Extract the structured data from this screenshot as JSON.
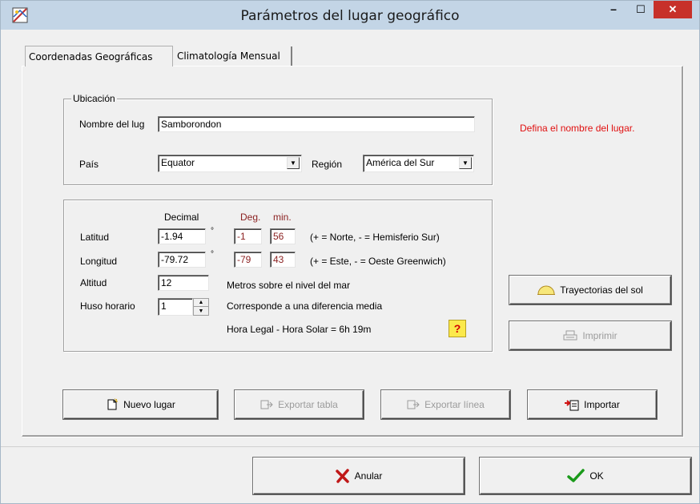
{
  "window": {
    "title": "Parámetros del lugar geográfico",
    "minimize_symbol": "–",
    "maximize_symbol": "☐",
    "close_symbol": "✕"
  },
  "tabs": [
    {
      "label": "Coordenadas Geográficas",
      "selected": true
    },
    {
      "label": "Climatología Mensual",
      "selected": false
    }
  ],
  "ubicacion": {
    "group_label": "Ubicación",
    "nombre_label": "Nombre del lug",
    "nombre_value": "Samborondon",
    "pais_label": "País",
    "pais_value": "Equator",
    "region_label": "Región",
    "region_value": "América del Sur"
  },
  "hint": "Defina el nombre del lugar.",
  "coords": {
    "decimal_header": "Decimal",
    "deg_header": "Deg.",
    "min_header": "min.",
    "degree_symbol": "°",
    "latitud": {
      "label": "Latitud",
      "decimal": "-1.94",
      "deg": "-1",
      "min": "56",
      "note": "(+ = Norte, - = Hemisferio Sur)"
    },
    "longitud": {
      "label": "Longitud",
      "decimal": "-79.72",
      "deg": "-79",
      "min": "43",
      "note": "(+ = Este, - = Oeste Greenwich)"
    },
    "altitud": {
      "label": "Altitud",
      "value": "12",
      "note": "Metros sobre el nivel del mar"
    },
    "huso": {
      "label": "Huso horario",
      "value": "1",
      "note": "Corresponde a una diferencia media"
    },
    "hora_legal": "Hora Legal - Hora Solar =   6h 19m",
    "help_symbol": "?"
  },
  "buttons": {
    "trayectorias": "Trayectorias del sol",
    "imprimir": "Imprimir",
    "nuevo_lugar": "Nuevo lugar",
    "exportar_tabla": "Exportar tabla",
    "exportar_linea": "Exportar línea",
    "importar": "Importar",
    "anular": "Anular",
    "ok": "OK"
  },
  "colors": {
    "hint": "#e01010",
    "deg_min_text": "#8a1f1f",
    "titlebar": "#c3d5e6",
    "close_button": "#c7312a"
  }
}
